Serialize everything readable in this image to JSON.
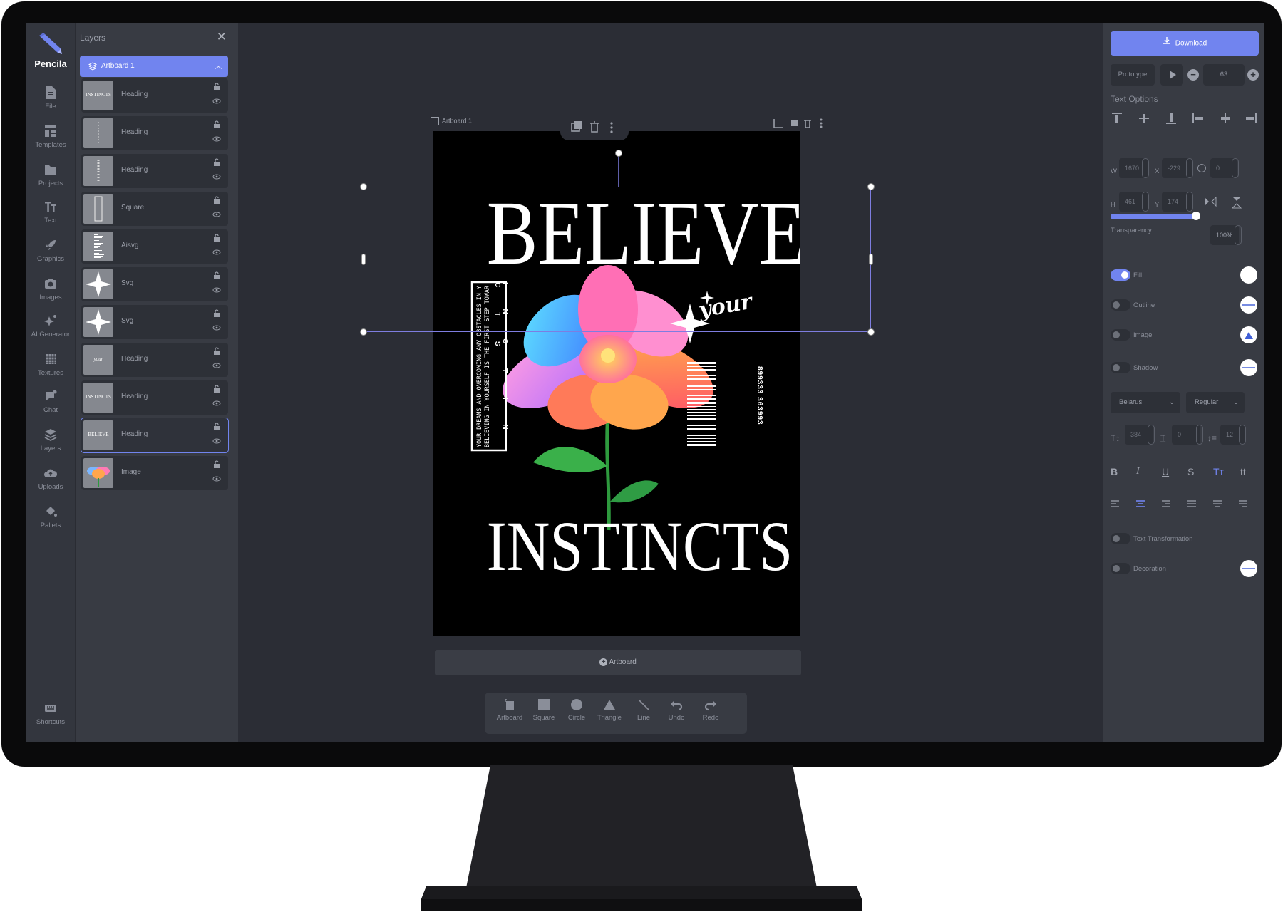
{
  "app": {
    "name": "Pencila"
  },
  "rail": {
    "items": [
      {
        "label": "File"
      },
      {
        "label": "Templates"
      },
      {
        "label": "Projects"
      },
      {
        "label": "Text"
      },
      {
        "label": "Graphics"
      },
      {
        "label": "Images"
      },
      {
        "label": "AI Generator"
      },
      {
        "label": "Textures"
      },
      {
        "label": "Chat"
      },
      {
        "label": "Layers"
      },
      {
        "label": "Uploads"
      },
      {
        "label": "Pallets"
      }
    ],
    "shortcuts": "Shortcuts"
  },
  "layers": {
    "title": "Layers",
    "artboard": "Artboard 1",
    "items": [
      {
        "name": "Heading",
        "thumb": "INSTINCTS"
      },
      {
        "name": "Heading",
        "thumb": ""
      },
      {
        "name": "Heading",
        "thumb": ""
      },
      {
        "name": "Square",
        "thumb": ""
      },
      {
        "name": "Aisvg",
        "thumb": ""
      },
      {
        "name": "Svg",
        "thumb": ""
      },
      {
        "name": "Svg",
        "thumb": ""
      },
      {
        "name": "Heading",
        "thumb": "your"
      },
      {
        "name": "Heading",
        "thumb": "INSTINCTS"
      },
      {
        "name": "Heading",
        "thumb": "BELIEVE"
      },
      {
        "name": "Image",
        "thumb": ""
      }
    ]
  },
  "canvas": {
    "artboard_label": "Artboard 1",
    "design": {
      "headline": "BELIEVE",
      "script": "your",
      "footer": "INSTINCTS",
      "vertical_letters": "I N S T I N C T S",
      "vertical_quote_1": "BELIEVING IN YOURSELF IS THE FIRST STEP TOWARDS ACHIEVING",
      "vertical_quote_2": "YOUR DREAMS AND OVERCOMING ANY OBSTACLES IN YOUR PATH",
      "barcode_number": "899333 363993"
    },
    "add_artboard": "Artboard"
  },
  "dock": {
    "items": [
      {
        "label": "Artboard"
      },
      {
        "label": "Square"
      },
      {
        "label": "Circle"
      },
      {
        "label": "Triangle"
      },
      {
        "label": "Line"
      },
      {
        "label": "Undo"
      },
      {
        "label": "Redo"
      }
    ]
  },
  "props": {
    "download": "Download",
    "prototype": "Prototype",
    "zoom": "63",
    "text_options": "Text Options",
    "w_label": "W",
    "w_value": "1670",
    "x_label": "X",
    "x_value": "-229",
    "rotation_value": "0",
    "h_label": "H",
    "h_value": "461",
    "y_label": "Y",
    "y_value": "174",
    "transparency_label": "Transparency",
    "transparency_value": "100%",
    "transparency": 0.95,
    "fill": "Fill",
    "outline": "Outline",
    "image": "Image",
    "shadow": "Shadow",
    "font_family": "Belarus",
    "font_weight": "Regular",
    "font_size": "384",
    "letter_spacing": "0",
    "line_height": "12",
    "text_transformation": "Text Transformation",
    "decoration": "Decoration"
  },
  "colors": {
    "accent": "#7184ef",
    "panel": "#383b43",
    "canvas": "#2b2d35"
  }
}
